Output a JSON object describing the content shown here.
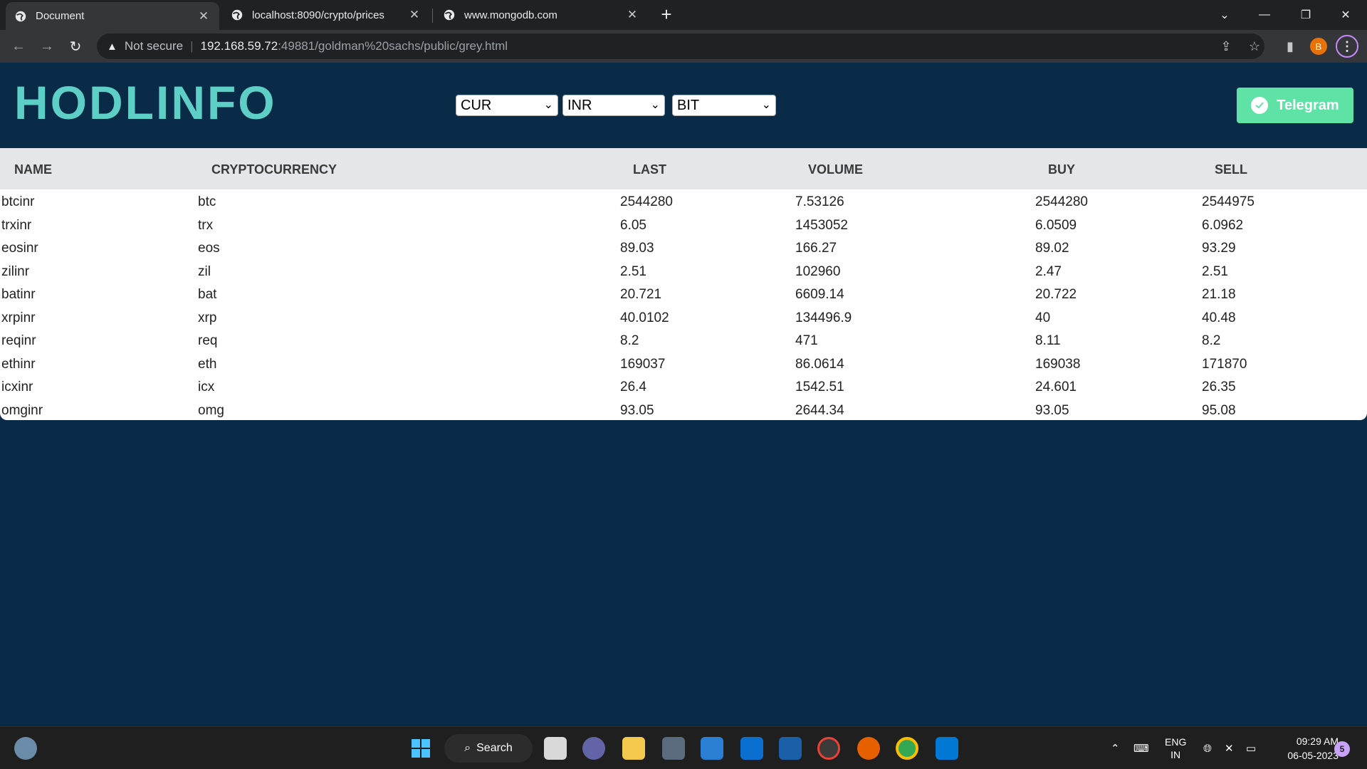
{
  "browser": {
    "tabs": [
      {
        "title": "Document",
        "active": true
      },
      {
        "title": "localhost:8090/crypto/prices",
        "active": false
      },
      {
        "title": "www.mongodb.com",
        "active": false
      }
    ],
    "new_tab": "+",
    "address": {
      "security_label": "Not secure",
      "host": "192.168.59.72",
      "path": ":49881/goldman%20sachs/public/grey.html"
    },
    "profile_initial": "B"
  },
  "page": {
    "logo": "HODLINFO",
    "selects": [
      {
        "value": "CUR"
      },
      {
        "value": "INR"
      },
      {
        "value": "BIT"
      }
    ],
    "telegram_label": "Telegram",
    "table": {
      "headers": [
        "NAME",
        "CRYPTOCURRENCY",
        "LAST",
        "VOLUME",
        "BUY",
        "SELL"
      ],
      "rows": [
        [
          "btcinr",
          "btc",
          "2544280",
          "7.53126",
          "2544280",
          "2544975"
        ],
        [
          "trxinr",
          "trx",
          "6.05",
          "1453052",
          "6.0509",
          "6.0962"
        ],
        [
          "eosinr",
          "eos",
          "89.03",
          "166.27",
          "89.02",
          "93.29"
        ],
        [
          "zilinr",
          "zil",
          "2.51",
          "102960",
          "2.47",
          "2.51"
        ],
        [
          "batinr",
          "bat",
          "20.721",
          "6609.14",
          "20.722",
          "21.18"
        ],
        [
          "xrpinr",
          "xrp",
          "40.0102",
          "134496.9",
          "40",
          "40.48"
        ],
        [
          "reqinr",
          "req",
          "8.2",
          "471",
          "8.11",
          "8.2"
        ],
        [
          "ethinr",
          "eth",
          "169037",
          "86.0614",
          "169038",
          "171870"
        ],
        [
          "icxinr",
          "icx",
          "26.4",
          "1542.51",
          "24.601",
          "26.35"
        ],
        [
          "omginr",
          "omg",
          "93.05",
          "2644.34",
          "93.05",
          "95.08"
        ]
      ]
    }
  },
  "taskbar": {
    "search_label": "Search",
    "lang_line1": "ENG",
    "lang_line2": "IN",
    "time": "09:29 AM",
    "date": "06-05-2023",
    "notification_count": "5"
  },
  "colors": {
    "page_bg": "#0a2b47",
    "logo": "#5dcfc6",
    "telegram_bg": "#5fe2a6"
  }
}
